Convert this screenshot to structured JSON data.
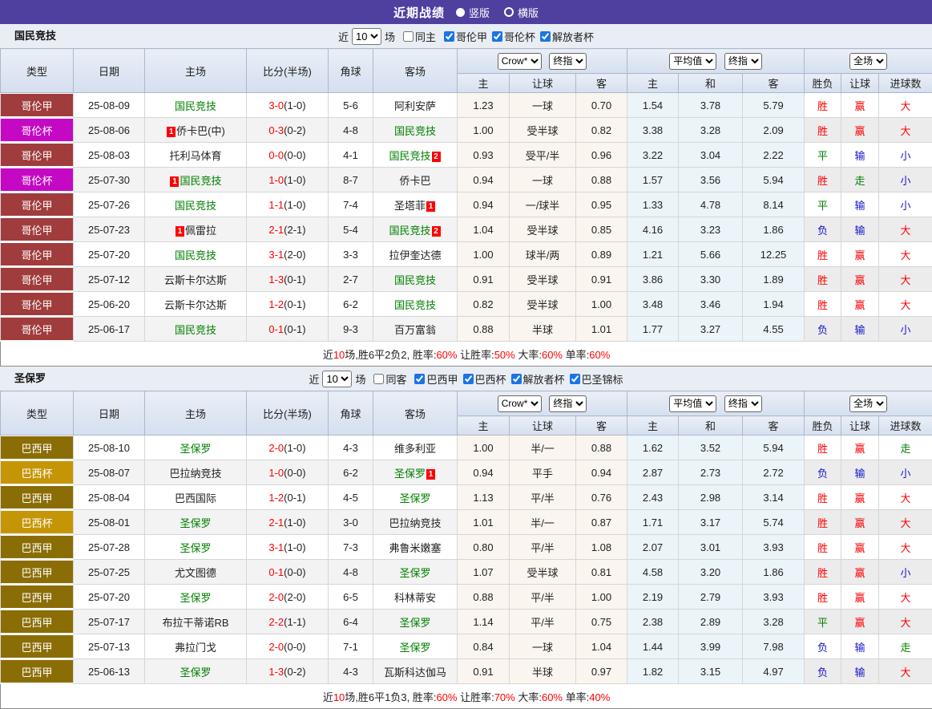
{
  "titlebar": {
    "title": "近期战绩",
    "radio_vertical": "竖版",
    "radio_horizontal": "横版",
    "bar_color": "#4F3F9E"
  },
  "filter_common": {
    "near_label": "近",
    "games_label": "场"
  },
  "header": {
    "cols": [
      "类型",
      "日期",
      "主场",
      "比分(半场)",
      "角球",
      "客场"
    ],
    "subcols": [
      "主",
      "让球",
      "客",
      "主",
      "和",
      "客",
      "胜负",
      "让球",
      "进球数"
    ],
    "dropdowns": {
      "crow": "Crow*",
      "final1": "终指",
      "avg": "平均值",
      "final2": "终指",
      "full": "全场"
    }
  },
  "league_colors": {
    "哥伦甲": "#A03C3C",
    "哥伦杯": "#C408C4",
    "巴西甲": "#8B6D05",
    "巴西杯": "#C69505"
  },
  "result_colors": {
    "r": "#FF0000",
    "g": "#008000",
    "b": "#1414CC"
  },
  "sections": [
    {
      "team": "国民竞技",
      "near_value": "10",
      "same_label": "同主",
      "same_checked": false,
      "leagues": [
        {
          "label": "哥伦甲",
          "checked": true
        },
        {
          "label": "哥伦杯",
          "checked": true
        },
        {
          "label": "解放者杯",
          "checked": true
        }
      ],
      "rows": [
        {
          "league": "哥伦甲",
          "date": "25-08-09",
          "home": {
            "name": "国民竞技",
            "green": true
          },
          "score": "3-0",
          "half": "(1-0)",
          "corner": "5-6",
          "away": {
            "name": "阿利安萨"
          },
          "crow": [
            "1.23",
            "一球",
            "0.70"
          ],
          "avg": [
            "1.54",
            "3.78",
            "5.79"
          ],
          "res": [
            [
              "胜",
              "r"
            ],
            [
              "赢",
              "r"
            ],
            [
              "大",
              "r"
            ]
          ]
        },
        {
          "league": "哥伦杯",
          "date": "25-08-06",
          "home": {
            "pre": "1",
            "name": "侨卡巴(中)"
          },
          "score": "0-3",
          "half": "(0-2)",
          "corner": "4-8",
          "away": {
            "name": "国民竞技",
            "green": true
          },
          "crow": [
            "1.00",
            "受半球",
            "0.82"
          ],
          "avg": [
            "3.38",
            "3.28",
            "2.09"
          ],
          "res": [
            [
              "胜",
              "r"
            ],
            [
              "赢",
              "r"
            ],
            [
              "大",
              "r"
            ]
          ]
        },
        {
          "league": "哥伦甲",
          "date": "25-08-03",
          "home": {
            "name": "托利马体育"
          },
          "score": "0-0",
          "half": "(0-0)",
          "corner": "4-1",
          "away": {
            "name": "国民竞技",
            "green": true,
            "post": "2"
          },
          "crow": [
            "0.93",
            "受平/半",
            "0.96"
          ],
          "avg": [
            "3.22",
            "3.04",
            "2.22"
          ],
          "res": [
            [
              "平",
              "g"
            ],
            [
              "输",
              "b"
            ],
            [
              "小",
              "b"
            ]
          ]
        },
        {
          "league": "哥伦杯",
          "date": "25-07-30",
          "home": {
            "pre": "1",
            "name": "国民竞技",
            "green": true
          },
          "score": "1-0",
          "half": "(1-0)",
          "corner": "8-7",
          "away": {
            "name": "侨卡巴"
          },
          "crow": [
            "0.94",
            "一球",
            "0.88"
          ],
          "avg": [
            "1.57",
            "3.56",
            "5.94"
          ],
          "res": [
            [
              "胜",
              "r"
            ],
            [
              "走",
              "g"
            ],
            [
              "小",
              "b"
            ]
          ]
        },
        {
          "league": "哥伦甲",
          "date": "25-07-26",
          "home": {
            "name": "国民竞技",
            "green": true
          },
          "score": "1-1",
          "half": "(1-0)",
          "corner": "7-4",
          "away": {
            "name": "圣塔菲",
            "post": "1"
          },
          "crow": [
            "0.94",
            "一/球半",
            "0.95"
          ],
          "avg": [
            "1.33",
            "4.78",
            "8.14"
          ],
          "res": [
            [
              "平",
              "g"
            ],
            [
              "输",
              "b"
            ],
            [
              "小",
              "b"
            ]
          ]
        },
        {
          "league": "哥伦甲",
          "date": "25-07-23",
          "home": {
            "pre": "1",
            "name": "佩雷拉"
          },
          "score": "2-1",
          "half": "(2-1)",
          "corner": "5-4",
          "away": {
            "name": "国民竞技",
            "green": true,
            "post": "2"
          },
          "crow": [
            "1.04",
            "受半球",
            "0.85"
          ],
          "avg": [
            "4.16",
            "3.23",
            "1.86"
          ],
          "res": [
            [
              "负",
              "b"
            ],
            [
              "输",
              "b"
            ],
            [
              "大",
              "r"
            ]
          ]
        },
        {
          "league": "哥伦甲",
          "date": "25-07-20",
          "home": {
            "name": "国民竞技",
            "green": true
          },
          "score": "3-1",
          "half": "(2-0)",
          "corner": "3-3",
          "away": {
            "name": "拉伊奎达德"
          },
          "crow": [
            "1.00",
            "球半/两",
            "0.89"
          ],
          "avg": [
            "1.21",
            "5.66",
            "12.25"
          ],
          "res": [
            [
              "胜",
              "r"
            ],
            [
              "赢",
              "r"
            ],
            [
              "大",
              "r"
            ]
          ]
        },
        {
          "league": "哥伦甲",
          "date": "25-07-12",
          "home": {
            "name": "云斯卡尔达斯"
          },
          "score": "1-3",
          "half": "(0-1)",
          "corner": "2-7",
          "away": {
            "name": "国民竞技",
            "green": true
          },
          "crow": [
            "0.91",
            "受半球",
            "0.91"
          ],
          "avg": [
            "3.86",
            "3.30",
            "1.89"
          ],
          "res": [
            [
              "胜",
              "r"
            ],
            [
              "赢",
              "r"
            ],
            [
              "大",
              "r"
            ]
          ]
        },
        {
          "league": "哥伦甲",
          "date": "25-06-20",
          "home": {
            "name": "云斯卡尔达斯"
          },
          "score": "1-2",
          "half": "(0-1)",
          "corner": "6-2",
          "away": {
            "name": "国民竞技",
            "green": true
          },
          "crow": [
            "0.82",
            "受半球",
            "1.00"
          ],
          "avg": [
            "3.48",
            "3.46",
            "1.94"
          ],
          "res": [
            [
              "胜",
              "r"
            ],
            [
              "赢",
              "r"
            ],
            [
              "大",
              "r"
            ]
          ]
        },
        {
          "league": "哥伦甲",
          "date": "25-06-17",
          "home": {
            "name": "国民竞技",
            "green": true
          },
          "score": "0-1",
          "half": "(0-1)",
          "corner": "9-3",
          "away": {
            "name": "百万富翁"
          },
          "crow": [
            "0.88",
            "半球",
            "1.01"
          ],
          "avg": [
            "1.77",
            "3.27",
            "4.55"
          ],
          "res": [
            [
              "负",
              "b"
            ],
            [
              "输",
              "b"
            ],
            [
              "小",
              "b"
            ]
          ]
        }
      ],
      "summary": [
        [
          "近",
          false
        ],
        [
          "10",
          true
        ],
        [
          "场,胜6平2负2, 胜率:",
          false
        ],
        [
          "60%",
          true
        ],
        [
          " 让胜率:",
          false
        ],
        [
          "50%",
          true
        ],
        [
          " 大率:",
          false
        ],
        [
          "60%",
          true
        ],
        [
          " 单率:",
          false
        ],
        [
          "60%",
          true
        ]
      ]
    },
    {
      "team": "圣保罗",
      "near_value": "10",
      "same_label": "同客",
      "same_checked": false,
      "leagues": [
        {
          "label": "巴西甲",
          "checked": true
        },
        {
          "label": "巴西杯",
          "checked": true
        },
        {
          "label": "解放者杯",
          "checked": true
        },
        {
          "label": "巴圣锦标",
          "checked": true
        }
      ],
      "rows": [
        {
          "league": "巴西甲",
          "date": "25-08-10",
          "home": {
            "name": "圣保罗",
            "green": true
          },
          "score": "2-0",
          "half": "(1-0)",
          "corner": "4-3",
          "away": {
            "name": "维多利亚"
          },
          "crow": [
            "1.00",
            "半/一",
            "0.88"
          ],
          "avg": [
            "1.62",
            "3.52",
            "5.94"
          ],
          "res": [
            [
              "胜",
              "r"
            ],
            [
              "赢",
              "r"
            ],
            [
              "走",
              "g"
            ]
          ]
        },
        {
          "league": "巴西杯",
          "date": "25-08-07",
          "home": {
            "name": "巴拉纳竞技"
          },
          "score": "1-0",
          "half": "(0-0)",
          "corner": "6-2",
          "away": {
            "name": "圣保罗",
            "green": true,
            "post": "1"
          },
          "crow": [
            "0.94",
            "平手",
            "0.94"
          ],
          "avg": [
            "2.87",
            "2.73",
            "2.72"
          ],
          "res": [
            [
              "负",
              "b"
            ],
            [
              "输",
              "b"
            ],
            [
              "小",
              "b"
            ]
          ]
        },
        {
          "league": "巴西甲",
          "date": "25-08-04",
          "home": {
            "name": "巴西国际"
          },
          "score": "1-2",
          "half": "(0-1)",
          "corner": "4-5",
          "away": {
            "name": "圣保罗",
            "green": true
          },
          "crow": [
            "1.13",
            "平/半",
            "0.76"
          ],
          "avg": [
            "2.43",
            "2.98",
            "3.14"
          ],
          "res": [
            [
              "胜",
              "r"
            ],
            [
              "赢",
              "r"
            ],
            [
              "大",
              "r"
            ]
          ]
        },
        {
          "league": "巴西杯",
          "date": "25-08-01",
          "home": {
            "name": "圣保罗",
            "green": true
          },
          "score": "2-1",
          "half": "(1-0)",
          "corner": "3-0",
          "away": {
            "name": "巴拉纳竞技"
          },
          "crow": [
            "1.01",
            "半/一",
            "0.87"
          ],
          "avg": [
            "1.71",
            "3.17",
            "5.74"
          ],
          "res": [
            [
              "胜",
              "r"
            ],
            [
              "赢",
              "r"
            ],
            [
              "大",
              "r"
            ]
          ]
        },
        {
          "league": "巴西甲",
          "date": "25-07-28",
          "home": {
            "name": "圣保罗",
            "green": true
          },
          "score": "3-1",
          "half": "(1-0)",
          "corner": "7-3",
          "away": {
            "name": "弗鲁米嫩塞"
          },
          "crow": [
            "0.80",
            "平/半",
            "1.08"
          ],
          "avg": [
            "2.07",
            "3.01",
            "3.93"
          ],
          "res": [
            [
              "胜",
              "r"
            ],
            [
              "赢",
              "r"
            ],
            [
              "大",
              "r"
            ]
          ]
        },
        {
          "league": "巴西甲",
          "date": "25-07-25",
          "home": {
            "name": "尤文图德"
          },
          "score": "0-1",
          "half": "(0-0)",
          "corner": "4-8",
          "away": {
            "name": "圣保罗",
            "green": true
          },
          "crow": [
            "1.07",
            "受半球",
            "0.81"
          ],
          "avg": [
            "4.58",
            "3.20",
            "1.86"
          ],
          "res": [
            [
              "胜",
              "r"
            ],
            [
              "赢",
              "r"
            ],
            [
              "小",
              "b"
            ]
          ]
        },
        {
          "league": "巴西甲",
          "date": "25-07-20",
          "home": {
            "name": "圣保罗",
            "green": true
          },
          "score": "2-0",
          "half": "(2-0)",
          "corner": "6-5",
          "away": {
            "name": "科林蒂安"
          },
          "crow": [
            "0.88",
            "平/半",
            "1.00"
          ],
          "avg": [
            "2.19",
            "2.79",
            "3.93"
          ],
          "res": [
            [
              "胜",
              "r"
            ],
            [
              "赢",
              "r"
            ],
            [
              "大",
              "r"
            ]
          ]
        },
        {
          "league": "巴西甲",
          "date": "25-07-17",
          "home": {
            "name": "布拉干蒂诺RB"
          },
          "score": "2-2",
          "half": "(1-1)",
          "corner": "6-4",
          "away": {
            "name": "圣保罗",
            "green": true
          },
          "crow": [
            "1.14",
            "平/半",
            "0.75"
          ],
          "avg": [
            "2.38",
            "2.89",
            "3.28"
          ],
          "res": [
            [
              "平",
              "g"
            ],
            [
              "赢",
              "r"
            ],
            [
              "大",
              "r"
            ]
          ]
        },
        {
          "league": "巴西甲",
          "date": "25-07-13",
          "home": {
            "name": "弗拉门戈"
          },
          "score": "2-0",
          "half": "(0-0)",
          "corner": "7-1",
          "away": {
            "name": "圣保罗",
            "green": true
          },
          "crow": [
            "0.84",
            "一球",
            "1.04"
          ],
          "avg": [
            "1.44",
            "3.99",
            "7.98"
          ],
          "res": [
            [
              "负",
              "b"
            ],
            [
              "输",
              "b"
            ],
            [
              "走",
              "g"
            ]
          ]
        },
        {
          "league": "巴西甲",
          "date": "25-06-13",
          "home": {
            "name": "圣保罗",
            "green": true
          },
          "score": "1-3",
          "half": "(0-2)",
          "corner": "4-3",
          "away": {
            "name": "瓦斯科达伽马"
          },
          "crow": [
            "0.91",
            "半球",
            "0.97"
          ],
          "avg": [
            "1.82",
            "3.15",
            "4.97"
          ],
          "res": [
            [
              "负",
              "b"
            ],
            [
              "输",
              "b"
            ],
            [
              "大",
              "r"
            ]
          ]
        }
      ],
      "summary": [
        [
          "近",
          false
        ],
        [
          "10",
          true
        ],
        [
          "场,胜6平1负3, 胜率:",
          false
        ],
        [
          "60%",
          true
        ],
        [
          " 让胜率:",
          false
        ],
        [
          "70%",
          true
        ],
        [
          " 大率:",
          false
        ],
        [
          "60%",
          true
        ],
        [
          " 单率:",
          false
        ],
        [
          "40%",
          true
        ]
      ]
    }
  ]
}
